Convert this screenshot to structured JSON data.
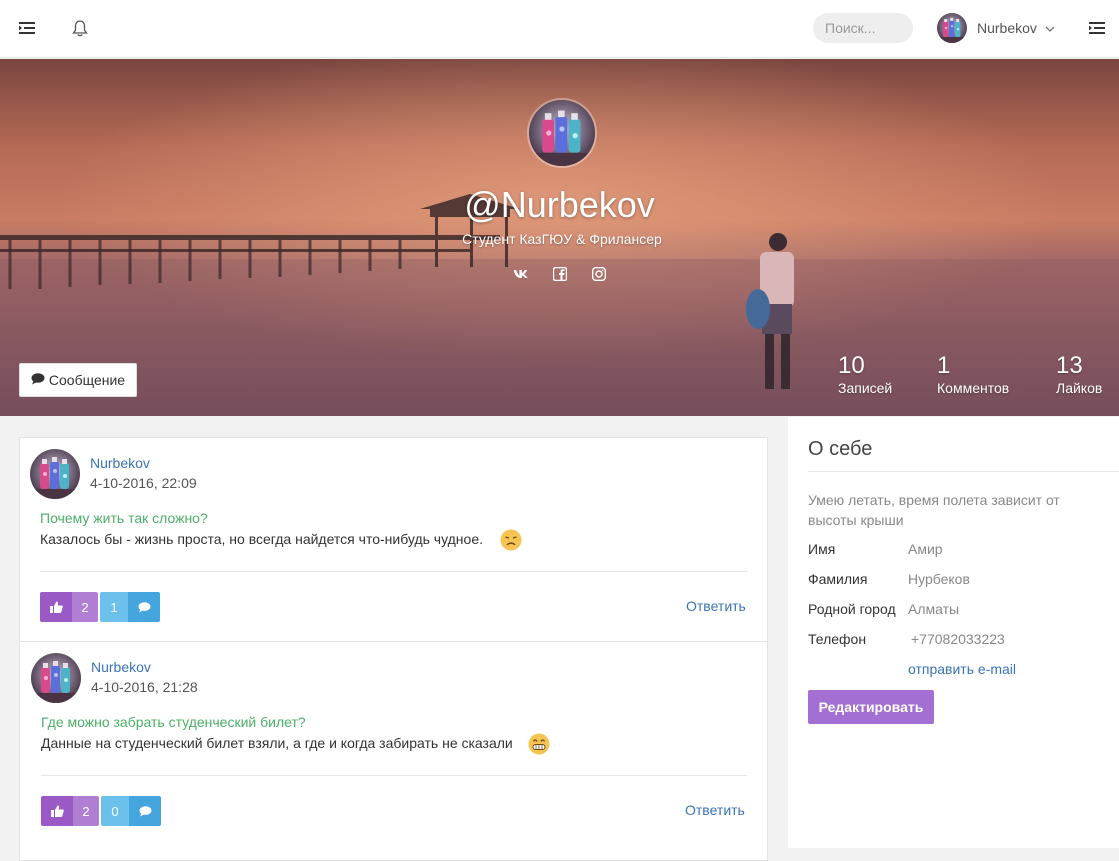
{
  "topbar": {
    "search_placeholder": "Поиск...",
    "user_name": "Nurbekov"
  },
  "profile": {
    "handle": "@Nurbekov",
    "tagline": "Студент КазГЮУ & Фрилансер",
    "socials": [
      "vk-icon",
      "facebook-icon",
      "instagram-icon"
    ],
    "message_button": "Сообщение",
    "stats": [
      {
        "value": "10",
        "label": "Записей"
      },
      {
        "value": "1",
        "label": "Комментов"
      },
      {
        "value": "13",
        "label": "Лайков"
      }
    ]
  },
  "posts": [
    {
      "author": "Nurbekov",
      "date": "4-10-2016, 22:09",
      "title": "Почему жить так сложно?",
      "text": "Казалось бы - жизнь проста, но всегда найдется что-нибудь чудное.",
      "emoji": "sad-face",
      "likes": "2",
      "comments": "1",
      "reply_label": "Ответить"
    },
    {
      "author": "Nurbekov",
      "date": "4-10-2016, 21:28",
      "title": "Где можно забрать студенческий билет?",
      "text": "Данные на студенческий билет взяли, а где и когда забирать не сказали",
      "emoji": "grin-face",
      "likes": "2",
      "comments": "0",
      "reply_label": "Ответить"
    }
  ],
  "about": {
    "title": "О себе",
    "bio": "Умею летать, время полета зависит от высоты крыши",
    "fields": [
      {
        "label": "Имя",
        "value": "Амир"
      },
      {
        "label": "Фамилия",
        "value": "Нурбеков"
      },
      {
        "label": "Родной город",
        "value": "Алматы"
      },
      {
        "label": "Телефон",
        "value": "+77082033223"
      }
    ],
    "email_link": "отправить e-mail",
    "edit_button": "Редактировать"
  },
  "colors": {
    "accent_purple": "#a36fd3",
    "like_purple": "#9b59c6",
    "comment_blue": "#45a6df",
    "link_blue": "#3a74b5",
    "title_green": "#4caf68"
  }
}
